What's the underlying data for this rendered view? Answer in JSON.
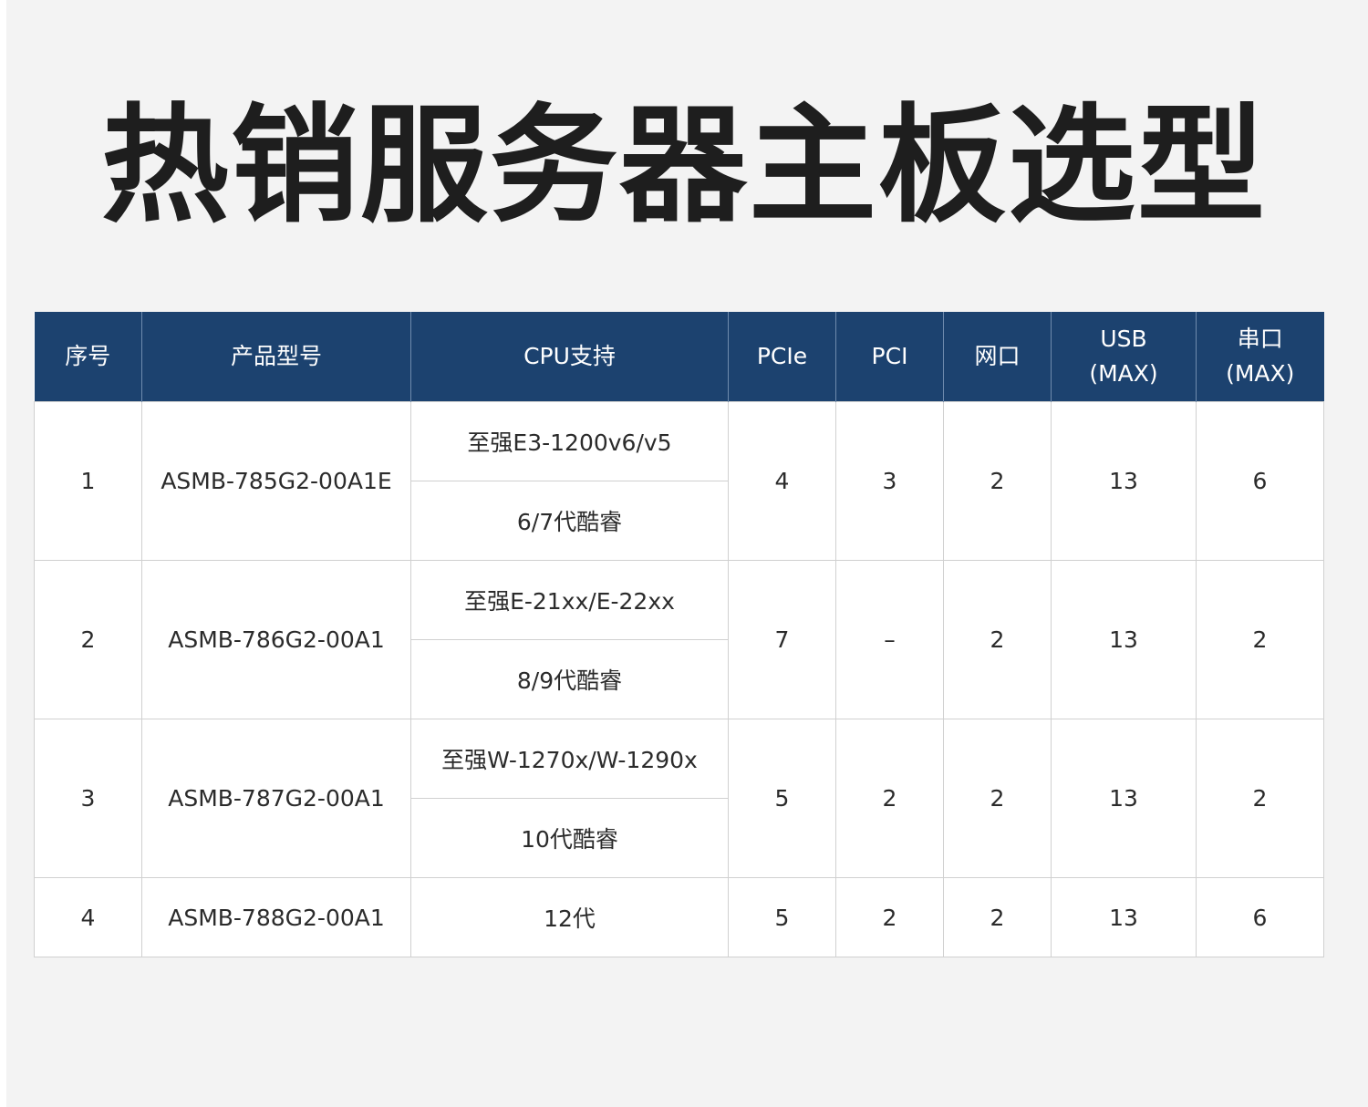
{
  "title": "热销服务器主板选型",
  "table": {
    "headers": {
      "index": "序号",
      "model": "产品型号",
      "cpu": "CPU支持",
      "pcie": "PCIe",
      "pci": "PCI",
      "lan": "网口",
      "usb_line1": "USB",
      "usb_line2": "(MAX)",
      "serial_line1": "串口",
      "serial_line2": "(MAX)"
    },
    "rows": [
      {
        "index": "1",
        "model": "ASMB-785G2-00A1E",
        "cpu1": "至强E3-1200v6/v5",
        "cpu2": "6/7代酷睿",
        "pcie": "4",
        "pci": "3",
        "lan": "2",
        "usb": "13",
        "serial": "6"
      },
      {
        "index": "2",
        "model": "ASMB-786G2-00A1",
        "cpu1": "至强E-21xx/E-22xx",
        "cpu2": "8/9代酷睿",
        "pcie": "7",
        "pci": "–",
        "lan": "2",
        "usb": "13",
        "serial": "2"
      },
      {
        "index": "3",
        "model": "ASMB-787G2-00A1",
        "cpu1": "至强W-1270x/W-1290x",
        "cpu2": "10代酷睿",
        "pcie": "5",
        "pci": "2",
        "lan": "2",
        "usb": "13",
        "serial": "2"
      },
      {
        "index": "4",
        "model": "ASMB-788G2-00A1",
        "cpu1": "12代",
        "pcie": "5",
        "pci": "2",
        "lan": "2",
        "usb": "13",
        "serial": "6"
      }
    ]
  },
  "colors": {
    "header_bg": "#1c426f",
    "page_bg": "#f3f3f3",
    "title": "#1e1e1e"
  }
}
